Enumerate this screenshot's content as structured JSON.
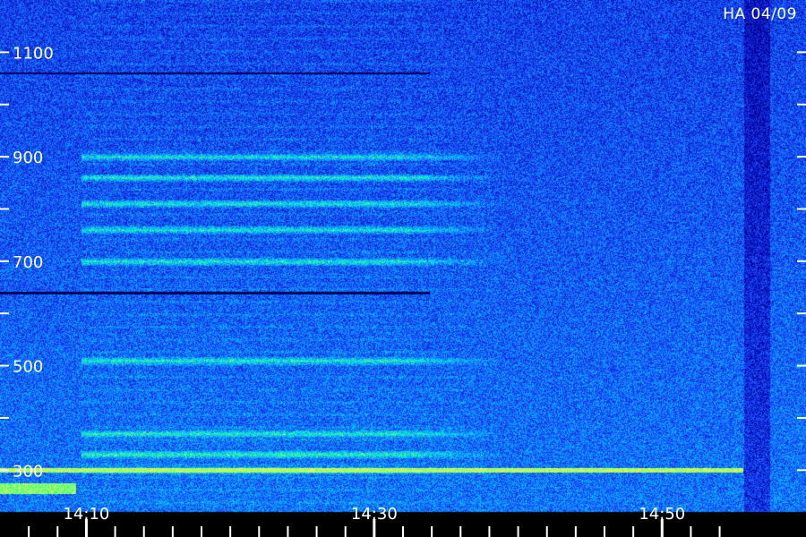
{
  "station_label": "HA 04/09",
  "chart_data": {
    "type": "heatmap",
    "title": "",
    "xlabel": "",
    "ylabel": "",
    "y_tick_labels": [
      "1100",
      "900",
      "700",
      "500",
      "300"
    ],
    "y_tick_values": [
      1100,
      900,
      700,
      500,
      300
    ],
    "y_minor_tick_values": [
      300,
      400,
      500,
      600,
      700,
      800,
      900,
      1000,
      1100
    ],
    "ylim": [
      220,
      1200
    ],
    "x_tick_labels": [
      "14:10",
      "14:30",
      "14:50"
    ],
    "x_tick_values_min": [
      10,
      30,
      50
    ],
    "x_minor_tick_values_min": [
      6,
      8,
      10,
      12,
      14,
      16,
      18,
      20,
      22,
      24,
      26,
      28,
      30,
      32,
      34,
      36,
      38,
      40,
      42,
      44,
      46,
      48,
      50,
      52,
      54
    ],
    "xlim_min": [
      4,
      60
    ],
    "colormap": [
      "#000040",
      "#0000a0",
      "#1e46ff",
      "#00c8ff",
      "#30ff90",
      "#ffff40"
    ],
    "bright_bands_y": [
      300,
      330,
      370,
      510,
      700,
      760,
      810,
      860,
      900
    ],
    "dark_lines_y": [
      640,
      1060
    ],
    "activity_end_min": 32
  }
}
